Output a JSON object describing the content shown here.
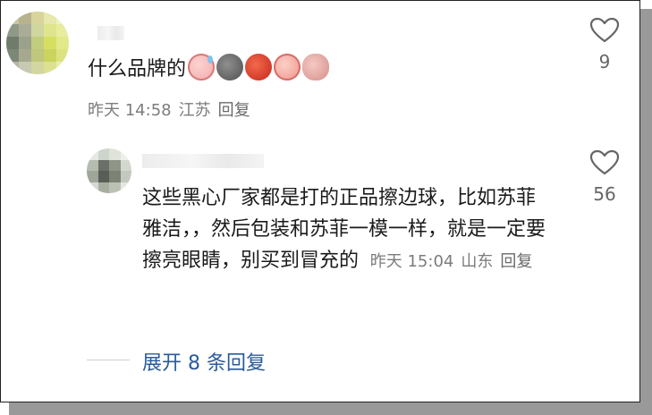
{
  "comment1": {
    "text": "什么品牌的",
    "emojis": [
      "sweat-face-emoji",
      "gray-face-emoji",
      "angry-face-emoji",
      "laugh-face-emoji",
      "facepalm-face-emoji"
    ],
    "time": "昨天 14:58",
    "location": "江苏",
    "reply_label": "回复",
    "likes": "9"
  },
  "comment2": {
    "text": "这些黑心厂家都是打的正品擦边球，比如苏菲雅洁，，然后包装和苏菲一模一样，就是一定要擦亮眼睛，别买到冒充的",
    "time": "昨天 15:04",
    "location": "山东",
    "reply_label": "回复",
    "likes": "56"
  },
  "expand_label": "展开 8 条回复",
  "colors": {
    "link": "#2a5a9b",
    "meta": "#7c7c7c",
    "icon": "#666666"
  }
}
